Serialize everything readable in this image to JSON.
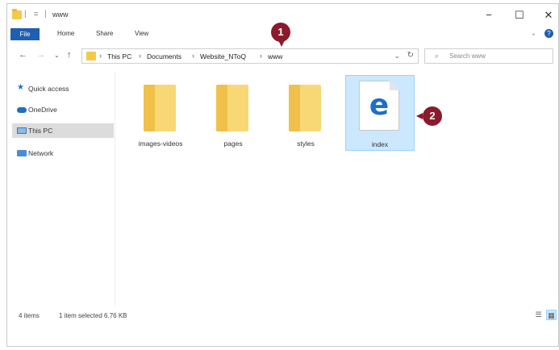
{
  "window": {
    "title": "www",
    "quick_access_glyph": "=",
    "separator": "|",
    "minimize": "−",
    "maximize": "☐",
    "close": "✕"
  },
  "ribbon": {
    "tabs": [
      "File",
      "Home",
      "Share",
      "View"
    ],
    "expand_glyph": "⌄",
    "help_glyph": "?"
  },
  "nav": {
    "back": "←",
    "forward": "→",
    "recent": "⌄",
    "up": "↑",
    "breadcrumb": [
      "This PC",
      "Documents",
      "Website_NToQ",
      "www"
    ],
    "crumb_sep": "›",
    "dropdown": "⌄",
    "refresh": "↻",
    "search_placeholder": "Search www",
    "search_glyph": "⌕"
  },
  "sidebar": {
    "items": [
      {
        "label": "Quick access",
        "icon": "star-icon"
      },
      {
        "label": "OneDrive",
        "icon": "cloud-icon"
      },
      {
        "label": "This PC",
        "icon": "computer-icon",
        "selected": true
      },
      {
        "label": "Network",
        "icon": "network-icon"
      }
    ]
  },
  "files": [
    {
      "name": "images-videos",
      "type": "folder"
    },
    {
      "name": "pages",
      "type": "folder"
    },
    {
      "name": "styles",
      "type": "folder"
    },
    {
      "name": "index",
      "type": "html",
      "icon_glyph": "e",
      "selected": true
    }
  ],
  "callouts": [
    "1",
    "2"
  ],
  "status": {
    "item_count": "4 items",
    "selection": "1 item selected  6.76 KB"
  },
  "view_modes": {
    "details": "☰",
    "large_icons": "▦"
  },
  "colors": {
    "accent": "#1f5fb2",
    "callout": "#8b1a2b",
    "selection": "#cce8ff",
    "folder": "#f8d775"
  }
}
